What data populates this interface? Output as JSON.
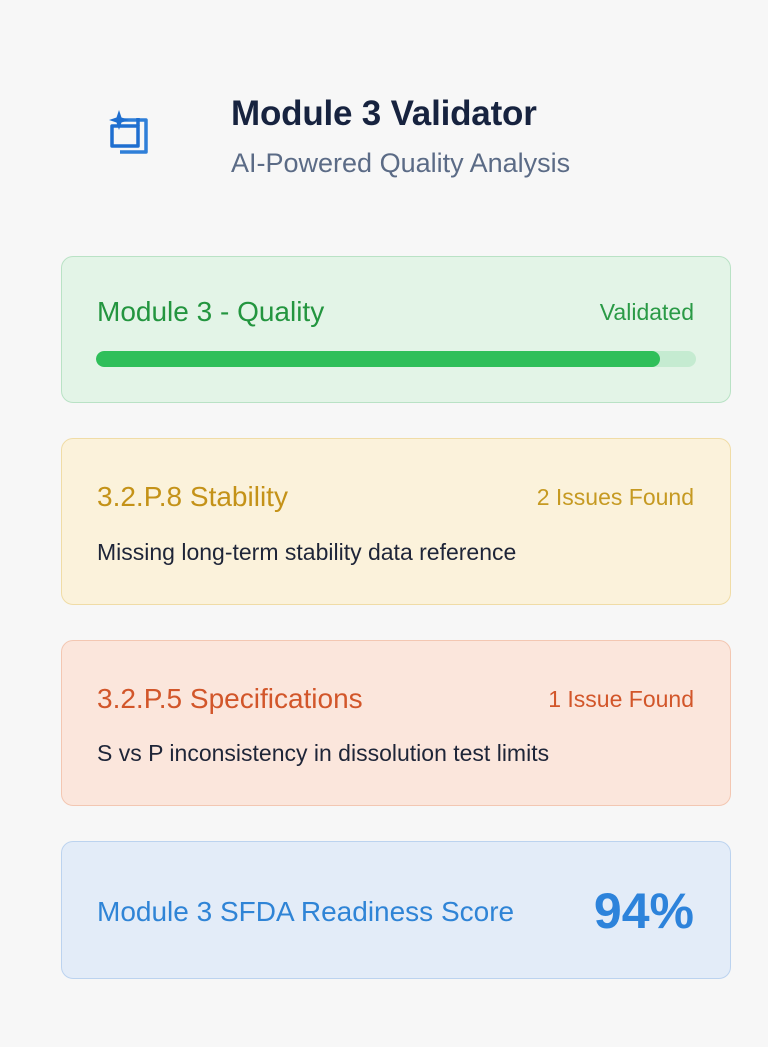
{
  "header": {
    "title": "Module 3 Validator",
    "subtitle": "AI-Powered Quality Analysis",
    "logo_icon": "sparkle-stack-icon"
  },
  "cards": {
    "quality": {
      "title": "Module 3 - Quality",
      "status": "Validated",
      "progress_percent": 94,
      "color": "#23953f"
    },
    "stability": {
      "title": "3.2.P.8 Stability",
      "status": "2 Issues Found",
      "description": "Missing long-term stability data reference",
      "color": "#c49218"
    },
    "specifications": {
      "title": "3.2.P.5 Specifications",
      "status": "1 Issue Found",
      "description": "S vs P inconsistency in dissolution test limits",
      "color": "#d2562a"
    },
    "score": {
      "label": "Module 3 SFDA Readiness Score",
      "value": "94%",
      "color": "#2d83db"
    }
  }
}
